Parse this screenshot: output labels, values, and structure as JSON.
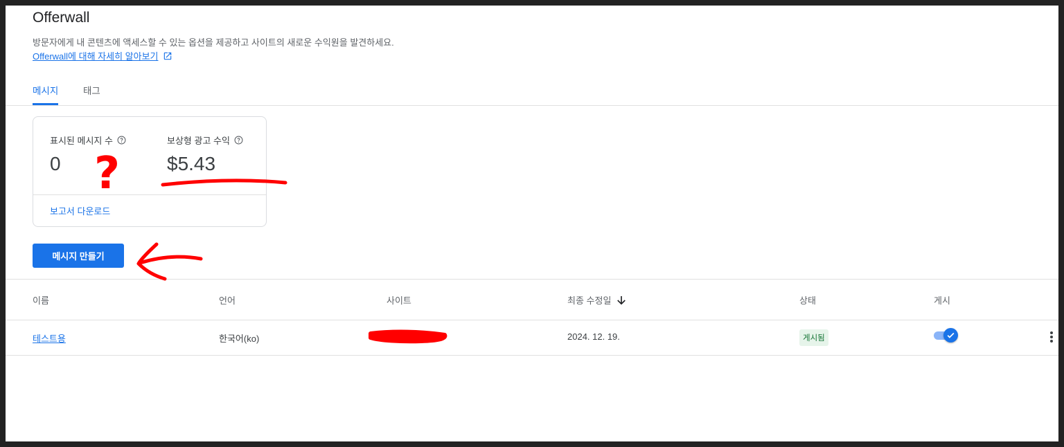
{
  "header": {
    "title": "Offerwall",
    "description": "방문자에게 내 콘텐츠에 액세스할 수 있는 옵션을 제공하고 사이트의 새로운 수익원을 발견하세요.",
    "learn_more": "Offerwall에 대해 자세히 알아보기"
  },
  "tabs": [
    {
      "label": "메시지",
      "active": true
    },
    {
      "label": "태그",
      "active": false
    }
  ],
  "stats": {
    "messages_label": "표시된 메시지 수",
    "messages_value": "0",
    "revenue_label": "보상형 광고 수익",
    "revenue_value": "$5.43",
    "download_label": "보고서 다운로드"
  },
  "create_button": "메시지 만들기",
  "table": {
    "headers": {
      "name": "이름",
      "language": "언어",
      "site": "사이트",
      "modified": "최종 수정일",
      "status": "상태",
      "publish": "게시"
    },
    "rows": [
      {
        "name": "테스트용",
        "language": "한국어(ko)",
        "site": "",
        "modified": "2024. 12. 19.",
        "status": "게시됨",
        "published": true
      }
    ]
  },
  "annotations": {
    "question_mark": "?"
  },
  "colors": {
    "accent": "#1a73e8",
    "annotation": "#ff0000",
    "status_bg": "#e6f4ea",
    "status_text": "#137333"
  }
}
